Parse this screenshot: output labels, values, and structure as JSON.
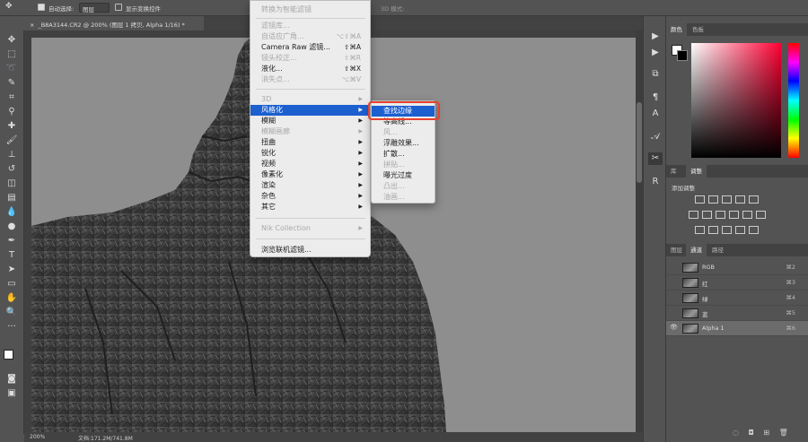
{
  "options_bar": {
    "move_icon": "move-icon",
    "auto_select_label": "自动选择:",
    "auto_select_value": "图层",
    "show_transform_label": "显示变换控件",
    "mode_3d_label": "3D 模式:"
  },
  "document": {
    "tab_title": "_B8A3144.CR2 @ 200% (图层 1 拷贝, Alpha 1/16) *",
    "zoom": "200%",
    "doc_size": "文档:171.2M/741.8M"
  },
  "filter_menu": {
    "items": [
      {
        "label": "转换为智能滤镜",
        "shortcut": "",
        "disabled": true
      },
      {
        "label": "滤镜库...",
        "shortcut": "",
        "disabled": true
      },
      {
        "label": "自适应广角...",
        "shortcut": "⌥⇧⌘A",
        "disabled": true
      },
      {
        "label": "Camera Raw 滤镜...",
        "shortcut": "⇧⌘A",
        "disabled": false
      },
      {
        "label": "镜头校正...",
        "shortcut": "⇧⌘R",
        "disabled": true
      },
      {
        "label": "液化...",
        "shortcut": "⇧⌘X",
        "disabled": false
      },
      {
        "label": "消失点...",
        "shortcut": "⌥⌘V",
        "disabled": true
      },
      {
        "label": "3D",
        "submenu": true,
        "disabled": true
      },
      {
        "label": "风格化",
        "submenu": true,
        "selected": true
      },
      {
        "label": "模糊",
        "submenu": true
      },
      {
        "label": "模糊画廊",
        "submenu": true,
        "disabled": true
      },
      {
        "label": "扭曲",
        "submenu": true
      },
      {
        "label": "锐化",
        "submenu": true
      },
      {
        "label": "视频",
        "submenu": true
      },
      {
        "label": "像素化",
        "submenu": true
      },
      {
        "label": "渲染",
        "submenu": true
      },
      {
        "label": "杂色",
        "submenu": true
      },
      {
        "label": "其它",
        "submenu": true
      },
      {
        "label": "Nik Collection",
        "submenu": true,
        "disabled": true
      },
      {
        "label": "浏览联机滤镜...",
        "disabled": false
      }
    ]
  },
  "stylize_submenu": {
    "items": [
      {
        "label": "查找边缘",
        "selected": true
      },
      {
        "label": "等高线...",
        "disabled": false
      },
      {
        "label": "风...",
        "disabled": true
      },
      {
        "label": "浮雕效果...",
        "disabled": false
      },
      {
        "label": "扩散...",
        "disabled": false
      },
      {
        "label": "拼贴...",
        "disabled": true
      },
      {
        "label": "曝光过度",
        "disabled": false
      },
      {
        "label": "凸出...",
        "disabled": true
      },
      {
        "label": "油画...",
        "disabled": true
      }
    ]
  },
  "panels": {
    "color_tabs": [
      "颜色",
      "色板"
    ],
    "adjust_tabs": [
      "库",
      "调整"
    ],
    "adjust_add_label": "添加调整",
    "channel_tabs": [
      "图层",
      "通道",
      "路径"
    ],
    "channels": [
      {
        "name": "RGB",
        "shortcut": "⌘2",
        "active": false
      },
      {
        "name": "红",
        "shortcut": "⌘3",
        "active": false
      },
      {
        "name": "绿",
        "shortcut": "⌘4",
        "active": false
      },
      {
        "name": "蓝",
        "shortcut": "⌘5",
        "active": false
      },
      {
        "name": "Alpha 1",
        "shortcut": "⌘6",
        "active": true
      }
    ]
  },
  "colors": {
    "menu_selection": "#1c5fcf",
    "callout": "#e8412e"
  }
}
